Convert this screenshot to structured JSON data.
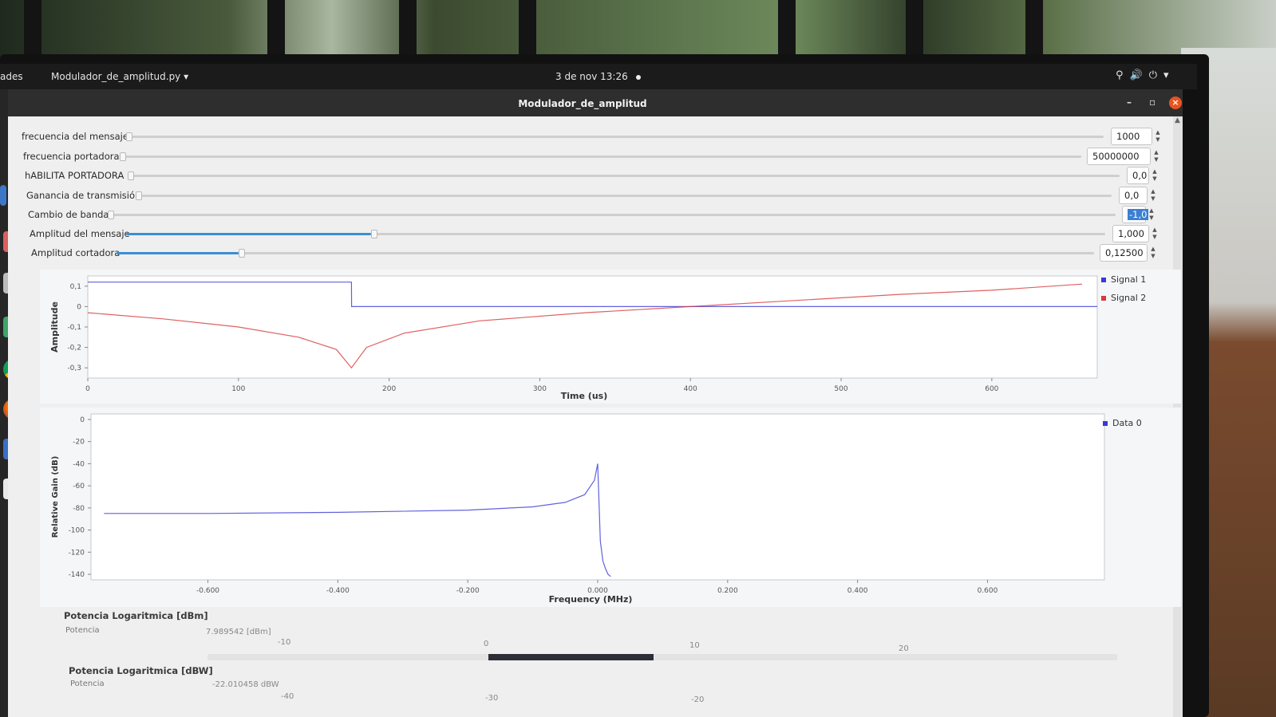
{
  "system": {
    "activities_label": "ades",
    "app_menu_label": "Modulador_de_amplitud.py",
    "clock": "3 de nov  13:26",
    "tray_icons": [
      "accessibility-icon",
      "volume-icon",
      "power-icon",
      "chevron-down-icon"
    ]
  },
  "dock": {
    "icons": [
      "files-icon",
      "notes-icon",
      "files-manager-icon",
      "spreadsheet-icon",
      "chrome-icon",
      "firefox-icon",
      "editor-icon",
      "gnuradio-icon",
      "trash-icon"
    ],
    "grid_icon": "show-apps-icon"
  },
  "window": {
    "title": "Modulador_de_amplitud",
    "minimize": "–",
    "maximize": "▫",
    "close": "×"
  },
  "controls": [
    {
      "label": "frecuencia del mensaje",
      "value": "1000",
      "fraction": 0.0
    },
    {
      "label": "frecuencia portadora",
      "value": "50000000",
      "fraction": 0.0
    },
    {
      "label": "hABILITA PORTADORA",
      "value": "0,0",
      "fraction": 0.0
    },
    {
      "label": "Ganancia de transmisión",
      "value": "0,0",
      "fraction": 0.0
    },
    {
      "label": "Cambio de banda",
      "value": "-1,0",
      "fraction": 0.0,
      "selected": true
    },
    {
      "label": "Amplitud  del mensaje",
      "value": "1,000",
      "fraction": 0.25
    },
    {
      "label": "Amplitud cortadora",
      "value": "0,12500",
      "fraction": 0.125
    }
  ],
  "time_plot": {
    "ylabel": "Amplitude",
    "xlabel": "Time (us)",
    "yticks": [
      "0,1",
      "0",
      "-0,1",
      "-0,2",
      "-0,3"
    ],
    "xticks": [
      "0",
      "100",
      "200",
      "300",
      "400",
      "500",
      "600"
    ],
    "legend": [
      {
        "name": "Signal 1",
        "color": "#3a3ad6"
      },
      {
        "name": "Signal 2",
        "color": "#d63a3a"
      }
    ]
  },
  "freq_plot": {
    "ylabel": "Relative Gain (dB)",
    "xlabel": "Frequency (MHz)",
    "yticks": [
      "0",
      "-20",
      "-40",
      "-60",
      "-80",
      "-100",
      "-120",
      "-140"
    ],
    "xticks": [
      "-0.600",
      "-0.400",
      "-0.200",
      "0.000",
      "0.200",
      "0.400",
      "0.600"
    ],
    "legend": [
      {
        "name": "Data 0",
        "color": "#3a3ad6"
      }
    ]
  },
  "chart_data": [
    {
      "type": "line",
      "xlabel": "Time (us)",
      "ylabel": "Amplitude",
      "xlim": [
        0,
        670
      ],
      "ylim": [
        -0.35,
        0.15
      ],
      "series": [
        {
          "name": "Signal 1",
          "x": [
            0,
            175,
            175.1,
            670
          ],
          "y": [
            0.12,
            0.12,
            0.0,
            0.0
          ]
        },
        {
          "name": "Signal 2",
          "x": [
            0,
            50,
            100,
            140,
            165,
            175,
            185,
            210,
            260,
            330,
            400,
            470,
            540,
            600,
            660
          ],
          "y": [
            -0.03,
            -0.06,
            -0.1,
            -0.15,
            -0.21,
            -0.3,
            -0.2,
            -0.13,
            -0.07,
            -0.03,
            0.0,
            0.03,
            0.06,
            0.08,
            0.11
          ]
        }
      ]
    },
    {
      "type": "line",
      "xlabel": "Frequency (MHz)",
      "ylabel": "Relative Gain (dB)",
      "xlim": [
        -0.78,
        0.78
      ],
      "ylim": [
        -145,
        5
      ],
      "series": [
        {
          "name": "Data 0",
          "x": [
            -0.76,
            -0.6,
            -0.4,
            -0.2,
            -0.1,
            -0.05,
            -0.02,
            -0.005,
            0.0,
            0.004,
            0.008,
            0.012,
            0.016,
            0.02
          ],
          "y": [
            -85,
            -85,
            -84,
            -82,
            -79,
            -75,
            -68,
            -55,
            -40,
            -110,
            -128,
            -135,
            -140,
            -142
          ]
        }
      ]
    }
  ],
  "gauges": [
    {
      "title": "Potencia Logaritmica [dBm]",
      "label": "Potencia",
      "value": "7.989542 [dBm]",
      "ticks": [
        "-10",
        "0",
        "10",
        "20"
      ],
      "level_fraction": 0.28
    },
    {
      "title": "Potencia Logaritmica [dBW]",
      "label": "Potencia",
      "value": "-22.010458 dBW",
      "ticks": [
        "-40",
        "-30",
        "-20"
      ]
    }
  ]
}
